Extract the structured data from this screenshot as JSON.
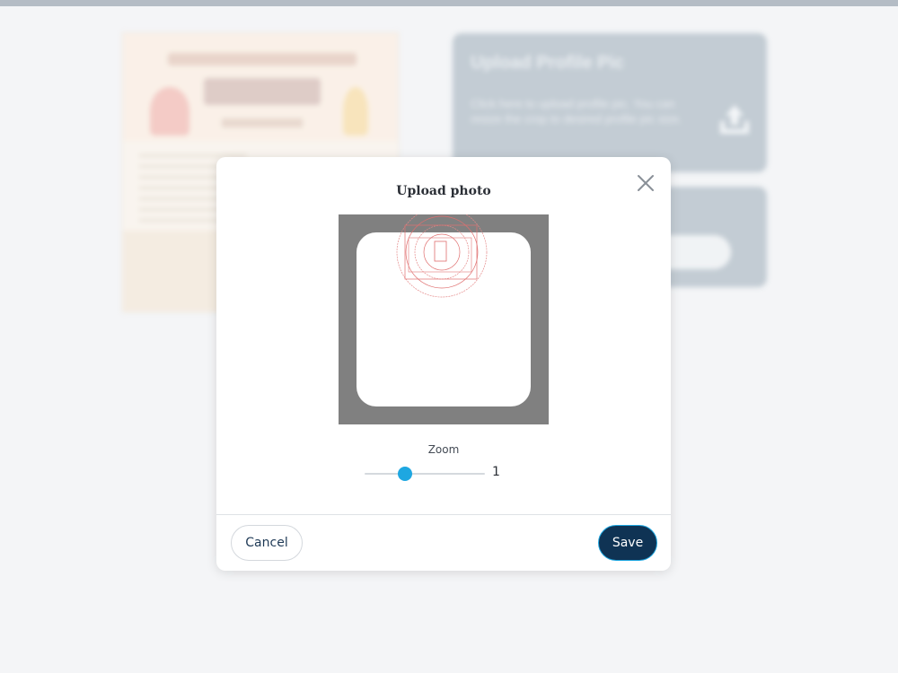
{
  "background": {
    "upload_card": {
      "title": "Upload Profile Pic",
      "description": "Click here to upload profile pic. You can resize the crop to desired profile pic size."
    }
  },
  "modal": {
    "title": "Upload photo",
    "zoom": {
      "label": "Zoom",
      "value": "1",
      "min": 0,
      "max": 3,
      "current": 1
    },
    "buttons": {
      "cancel_label": "Cancel",
      "save_label": "Save"
    }
  },
  "icons": {
    "close": "close-icon",
    "upload": "upload-icon"
  },
  "colors": {
    "accent": "#1ea7e1",
    "primary_button": "#0f3354",
    "card_bg": "#a3b1bd",
    "crop_bg": "#808080"
  }
}
